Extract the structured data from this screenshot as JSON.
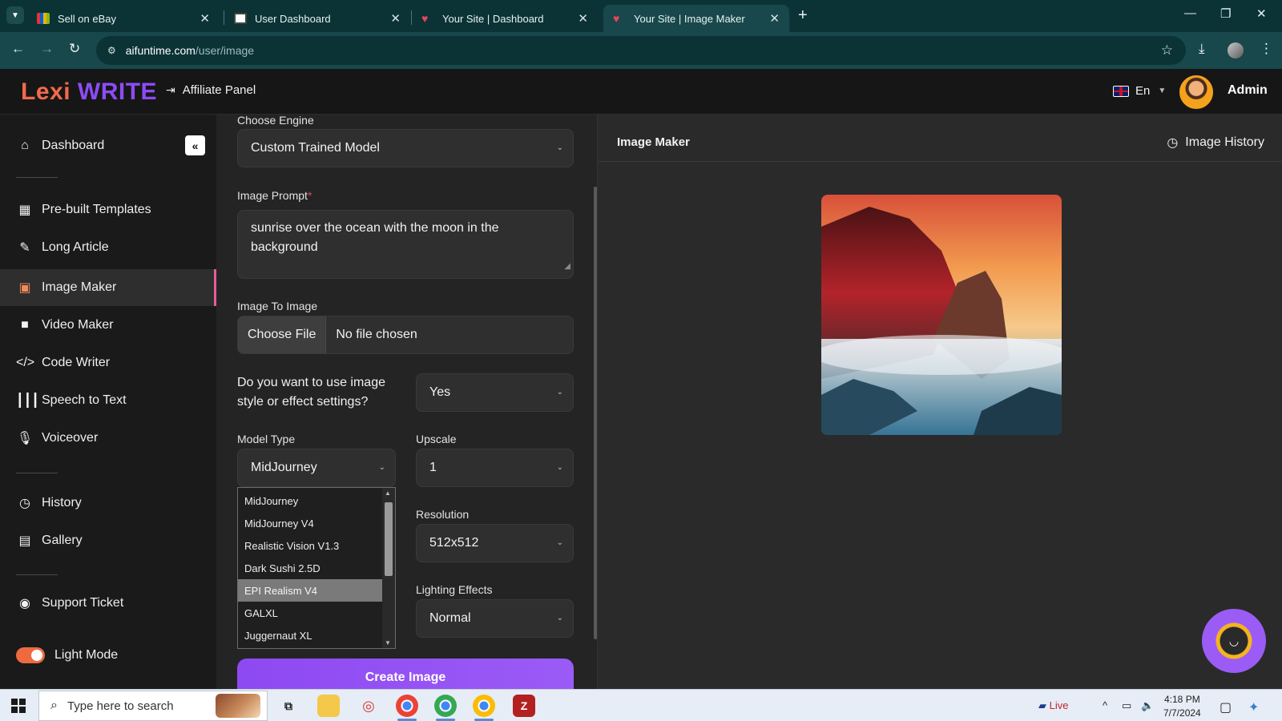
{
  "browser": {
    "tabs": [
      {
        "title": "Sell on eBay",
        "active": false
      },
      {
        "title": "User Dashboard",
        "active": false
      },
      {
        "title": "Your Site | Dashboard",
        "active": false
      },
      {
        "title": "Your Site | Image Maker",
        "active": true
      }
    ],
    "url_host": "aifuntime.com",
    "url_path": "/user/image"
  },
  "header": {
    "logo_part1": "Lexi",
    "logo_part2": "WRITE",
    "affiliate_label": "Affiliate Panel",
    "language": "En",
    "user_name": "Admin"
  },
  "sidebar": {
    "items": [
      {
        "label": "Dashboard",
        "icon": "home-icon"
      },
      {
        "label": "Pre-built Templates",
        "icon": "grid-icon"
      },
      {
        "label": "Long Article",
        "icon": "pen-icon"
      },
      {
        "label": "Image Maker",
        "icon": "image-icon"
      },
      {
        "label": "Video Maker",
        "icon": "video-icon"
      },
      {
        "label": "Code Writer",
        "icon": "code-icon"
      },
      {
        "label": "Speech to Text",
        "icon": "waveform-icon"
      },
      {
        "label": "Voiceover",
        "icon": "microphone-icon"
      },
      {
        "label": "History",
        "icon": "history-icon"
      },
      {
        "label": "Gallery",
        "icon": "gallery-icon"
      },
      {
        "label": "Support Ticket",
        "icon": "support-icon"
      }
    ],
    "active_item": "Image Maker",
    "mode_label": "Light Mode"
  },
  "form": {
    "engine_label": "Choose Engine",
    "engine_value": "Custom Trained Model",
    "prompt_label": "Image Prompt",
    "prompt_required_mark": "*",
    "prompt_value": "sunrise over the ocean with the moon in the background",
    "img2img_label": "Image To Image",
    "file_button": "Choose File",
    "file_status": "No file chosen",
    "style_question": "Do you want to use image style or effect settings?",
    "style_value": "Yes",
    "model_type_label": "Model Type",
    "model_type_value": "MidJourney",
    "model_options": [
      "MidJourney",
      "MidJourney V4",
      "Realistic Vision V1.3",
      "Dark Sushi 2.5D",
      "EPI Realism V4",
      "GALXL",
      "Juggernaut XL"
    ],
    "model_highlighted": "EPI Realism V4",
    "upscale_label": "Upscale",
    "upscale_value": "1",
    "resolution_label": "Resolution",
    "resolution_value": "512x512",
    "lighting_label": "Lighting Effects",
    "lighting_value": "Normal",
    "create_button": "Create Image"
  },
  "result": {
    "title": "Image Maker",
    "history_label": "Image History"
  },
  "taskbar": {
    "search_placeholder": "Type here to search",
    "news_label": "Live",
    "time": "4:18 PM",
    "date": "7/7/2024"
  },
  "colors": {
    "accent_purple": "#8e49f2",
    "logo_orange": "#f26a4b",
    "active_border": "#e85b9b",
    "toggle_orange": "#ef6a3f"
  }
}
